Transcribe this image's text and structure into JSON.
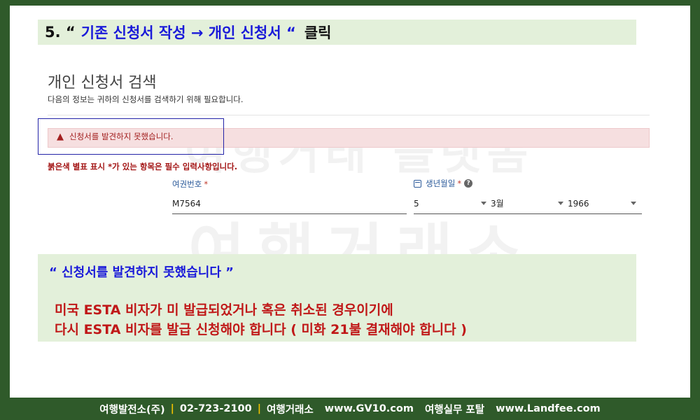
{
  "step_banner": {
    "number": "5. “",
    "text": "기존 신청서 작성  → 개인 신청서 “",
    "click": "클릭"
  },
  "watermark": {
    "line1": "여행거래 플랫폼",
    "line2": "여행거래소",
    "line3": "GV10.com"
  },
  "page": {
    "title": "개인 신청서 검색",
    "description": "다음의 정보는 귀하의 신청서를 검색하기 위해 필요합니다."
  },
  "alert": {
    "icon": "warning-triangle-icon",
    "message": "신청서를 발견하지 못했습니다."
  },
  "required_note": "붉은색 별표 표시 *가 있는 항목은 필수 입력사항입니다.",
  "form": {
    "passport": {
      "label": "여권번호",
      "required_mark": "*",
      "value": "M7564"
    },
    "dob": {
      "label": "생년월일",
      "required_mark": "*",
      "help_icon": "?",
      "day": "5",
      "month": "3월",
      "year": "1966"
    }
  },
  "info_box": {
    "title": "“ 신청서를 발견하지 못했습니다 ”",
    "line1": "미국 ESTA 비자가 미 발급되었거나 혹은 취소된 경우이기에",
    "line2": "다시 ESTA 비자를 발급 신청해야 합니다 ( 미화 21불 결재해야 합니다 )"
  },
  "footer": {
    "company": "여행발전소(주)",
    "separator": "|",
    "phone": "02-723-2100",
    "site_name": "여행거래소",
    "site_url": "www.GV10.com",
    "portal_name": "여행실무 포탈",
    "portal_url": "www.Landfee.com"
  },
  "colors": {
    "frame_bg": "#2f5a2a",
    "banner_bg": "#e3f0da",
    "blue_text": "#1a1ad9",
    "red_text": "#c01818",
    "alert_bg": "#f6dfe0"
  }
}
